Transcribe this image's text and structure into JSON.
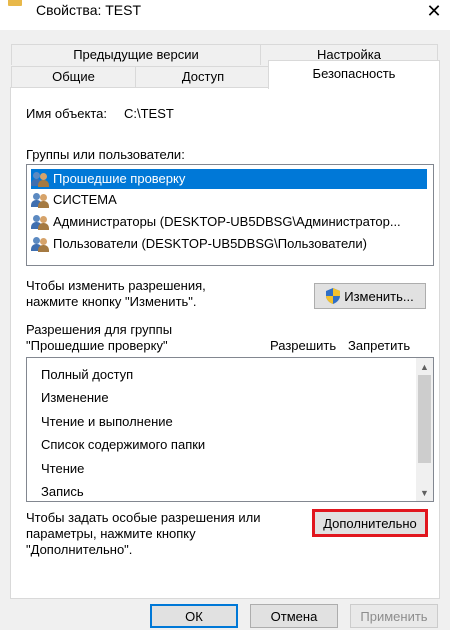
{
  "window": {
    "title": "Свойства: TEST"
  },
  "tabs": {
    "previous_versions": "Предыдущие версии",
    "settings": "Настройка",
    "general": "Общие",
    "access": "Доступ",
    "security": "Безопасность"
  },
  "object": {
    "label": "Имя объекта:",
    "value": "C:\\TEST"
  },
  "groups": {
    "label": "Группы или пользователи:",
    "items": [
      {
        "label": "Прошедшие проверку",
        "icon": "users-icon"
      },
      {
        "label": "СИСТЕМА",
        "icon": "users-icon"
      },
      {
        "label": "Администраторы (DESKTOP-UB5DBSG\\Администратор...",
        "icon": "users-icon"
      },
      {
        "label": "Пользователи (DESKTOP-UB5DBSG\\Пользователи)",
        "icon": "users-icon"
      }
    ],
    "selected_index": 0
  },
  "change": {
    "hint_line1": "Чтобы изменить разрешения,",
    "hint_line2": "нажмите кнопку \"Изменить\".",
    "button": "Изменить..."
  },
  "permissions": {
    "label_line1": "Разрешения для группы",
    "label_line2": "\"Прошедшие проверку\"",
    "allow_header": "Разрешить",
    "deny_header": "Запретить",
    "items": [
      "Полный доступ",
      "Изменение",
      "Чтение и выполнение",
      "Список содержимого папки",
      "Чтение",
      "Запись"
    ]
  },
  "advanced": {
    "hint_line1": "Чтобы задать особые разрешения или",
    "hint_line2": "параметры, нажмите кнопку",
    "hint_line3": "\"Дополнительно\".",
    "button": "Дополнительно"
  },
  "footer": {
    "ok": "ОК",
    "cancel": "Отмена",
    "apply": "Применить"
  },
  "colors": {
    "selection": "#0078d7",
    "highlight_border": "#e1161e"
  }
}
